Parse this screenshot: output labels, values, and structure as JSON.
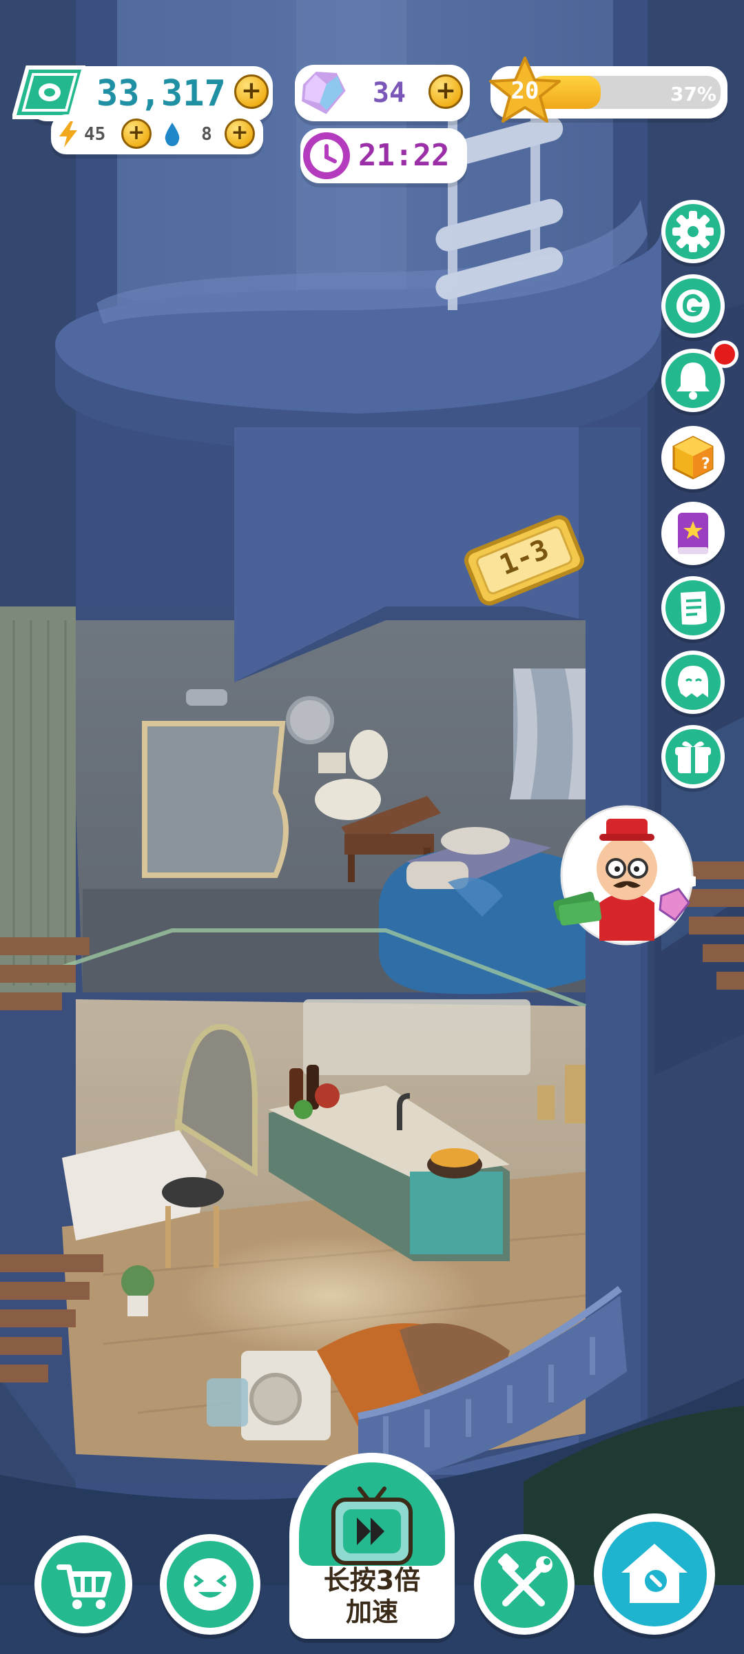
{
  "hud": {
    "cash": "33,317",
    "energy": "45",
    "water": "8",
    "gems": "34",
    "level": "20",
    "level_progress": 0.37,
    "level_progress_text": "37%",
    "timer": "21:22"
  },
  "floor_sign": "1-3",
  "side_menu": [
    {
      "name": "settings-icon"
    },
    {
      "name": "g-coin-icon"
    },
    {
      "name": "bell-icon",
      "badge": true
    },
    {
      "name": "mystery-box-icon"
    },
    {
      "name": "star-book-icon"
    },
    {
      "name": "notes-icon"
    },
    {
      "name": "ghost-chat-icon"
    },
    {
      "name": "gift-icon"
    }
  ],
  "bottom_bar": {
    "speedup_line1": "长按3倍",
    "speedup_line2": "加速"
  },
  "colors": {
    "accent_green": "#25b98f",
    "gold": "#f2b21c",
    "night_blue": "#3d5282"
  }
}
